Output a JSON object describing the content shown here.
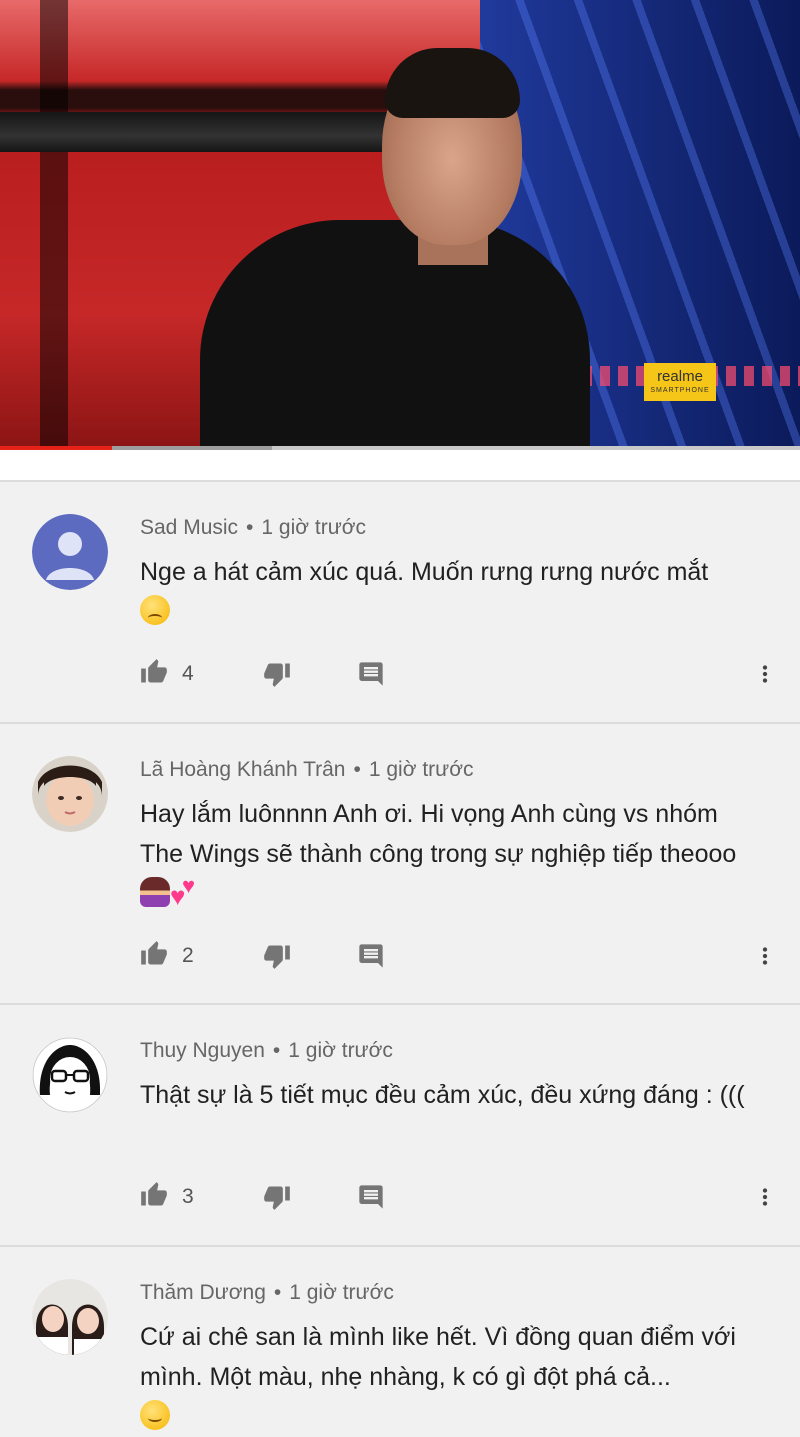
{
  "video": {
    "sponsor_badge": {
      "brand": "realme",
      "sub": "SMARTPHONE"
    },
    "progress": {
      "played_fraction": 0.14,
      "buffered_fraction": 0.34
    }
  },
  "comments": [
    {
      "author": "Sad Music",
      "time": "1 giờ trước",
      "text": "Nge a hát cảm xúc quá. Muốn rưng rưng nước mắt",
      "emoji_after": "sad-face-emoji",
      "likes": "4",
      "avatar": "default-avatar",
      "avatar_color": "#5c6bc0"
    },
    {
      "author": "Lã Hoàng Khánh Trân",
      "time": "1 giờ trước",
      "text": "Hay lắm luônnnn Anh ơi. Hi vọng Anh cùng vs nhóm The Wings sẽ thành công trong sự nghiệp tiếp theooo",
      "emoji_after": "person-gesturing-ok-emoji, two-hearts-emoji",
      "likes": "2",
      "avatar": "photo-avatar"
    },
    {
      "author": "Thuy Nguyen",
      "time": "1 giờ trước",
      "text": "Thật sự là 5 tiết mục đều cảm xúc, đều xứng đáng : (((",
      "likes": "3",
      "avatar": "cartoon-girl-avatar"
    },
    {
      "author": "Thăm Dương",
      "time": "1 giờ trước",
      "text": "Cứ ai chê san là mình like hết. Vì đồng quan điểm với mình. Một màu, nhẹ nhàng, k có gì đột phá cả...",
      "emoji_after": "slightly-smiling-face-emoji",
      "avatar": "two-girls-photo-avatar"
    }
  ],
  "colors": {
    "background": "#f1f1f1",
    "progress_played": "#e62117",
    "text_primary": "#212121",
    "text_secondary": "#666666",
    "icon": "#757575"
  }
}
